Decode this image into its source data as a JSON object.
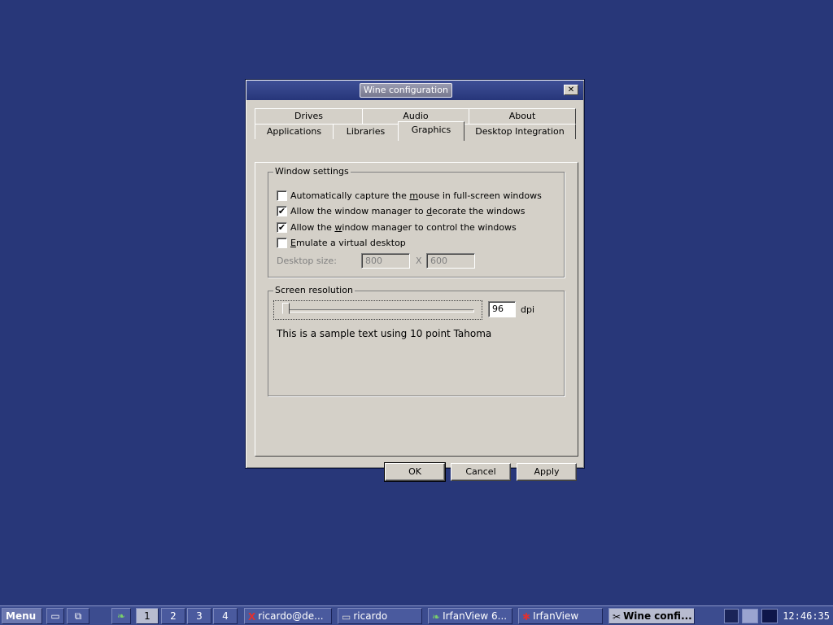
{
  "window": {
    "title": "Wine configuration",
    "close_glyph": "✕"
  },
  "tabs": {
    "row1": [
      "Drives",
      "Audio",
      "About"
    ],
    "row2": [
      "Applications",
      "Libraries",
      "Graphics",
      "Desktop Integration"
    ],
    "active": "Graphics"
  },
  "window_settings": {
    "title": "Window settings",
    "options": [
      {
        "pre": "Automatically capture the ",
        "u": "m",
        "post": "ouse in full-screen windows",
        "checked": false
      },
      {
        "pre": "Allow the window manager to ",
        "u": "d",
        "post": "ecorate the windows",
        "checked": true
      },
      {
        "pre": "Allow the ",
        "u": "w",
        "post": "indow manager to control the windows",
        "checked": true
      },
      {
        "pre": "",
        "u": "E",
        "post": "mulate a virtual desktop",
        "checked": false
      }
    ],
    "desktop_size_label": "Desktop size:",
    "desktop_width": "800",
    "separator": "X",
    "desktop_height": "600"
  },
  "screen_resolution": {
    "title": "Screen resolution",
    "dpi_value": "96",
    "dpi_unit": "dpi",
    "sample_text": "This is a sample text using 10 point Tahoma"
  },
  "buttons": {
    "ok": "OK",
    "cancel": "Cancel",
    "apply": "Apply"
  },
  "taskbar": {
    "menu_label": "Menu",
    "workspaces": [
      "1",
      "2",
      "3",
      "4"
    ],
    "active_workspace": "1",
    "tasks": [
      {
        "label": "ricardo@de...",
        "icon": "x-terminal-icon",
        "glyph": "X",
        "active": false
      },
      {
        "label": "ricardo",
        "icon": "folder-icon",
        "glyph": "▭",
        "active": false
      },
      {
        "label": "IrfanView 6...",
        "icon": "irfanview-icon",
        "glyph": "❧",
        "active": false
      },
      {
        "label": "IrfanView",
        "icon": "irfanview-red-icon",
        "glyph": "✱",
        "active": false
      },
      {
        "label": "Wine confi...",
        "icon": "wine-tools-icon",
        "glyph": "✂",
        "active": true
      }
    ],
    "clock": "12:46:35"
  },
  "colors": {
    "desktop": "#283779",
    "dialog_face": "#d4d0c8",
    "titlebar": "#2f3f85",
    "taskbar": "#3c4c8f"
  }
}
